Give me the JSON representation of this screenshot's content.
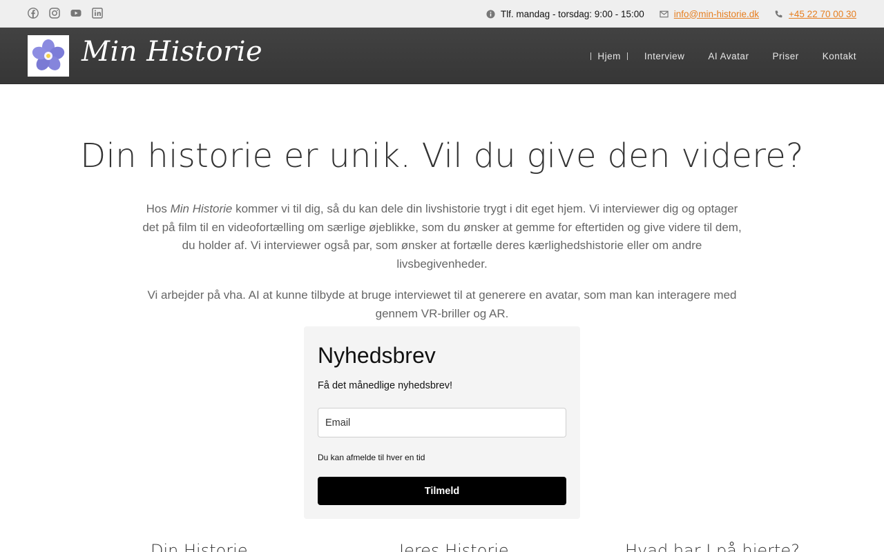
{
  "topbar": {
    "social": [
      {
        "icon": "facebook-icon"
      },
      {
        "icon": "instagram-icon"
      },
      {
        "icon": "youtube-icon"
      },
      {
        "icon": "linkedin-icon"
      }
    ],
    "hours": "Tlf. mandag - torsdag: 9:00 - 15:00",
    "email": "info@min-historie.dk",
    "phone": "+45 22 70 00 30"
  },
  "header": {
    "brand": "Min Historie",
    "nav": [
      "Hjem",
      "Interview",
      "AI Avatar",
      "Priser",
      "Kontakt"
    ]
  },
  "hero": {
    "title": "Din historie er unik. Vil du give den videre?",
    "p1_pre": "Hos ",
    "p1_em": "Min Historie",
    "p1_post": " kommer vi til dig, så du kan dele din livshistorie trygt i dit eget hjem. Vi interviewer dig og optager det på film til en videofortælling om særlige øjeblikke, som du ønsker at gemme for eftertiden og give videre til dem, du holder af. Vi interviewer også par, som ønsker at fortælle deres kærlighedshistorie eller om andre livsbegivenheder.",
    "p2": "Vi arbejder på vha. AI at kunne tilbyde at bruge interviewet til at generere en avatar, som man kan interagere med gennem VR-briller og AR."
  },
  "newsletter": {
    "title": "Nyhedsbrev",
    "subtitle": "Få det månedlige nyhedsbrev!",
    "email_placeholder": "Email",
    "note": "Du kan afmelde til hver en tid",
    "button": "Tilmeld"
  },
  "columns": [
    "Din Historie",
    "Jeres Historie",
    "Hvad har I på hjerte?"
  ],
  "colors": {
    "accent": "#e67e1f",
    "header_bg": "#3c3c3c",
    "button_bg": "#000000"
  }
}
